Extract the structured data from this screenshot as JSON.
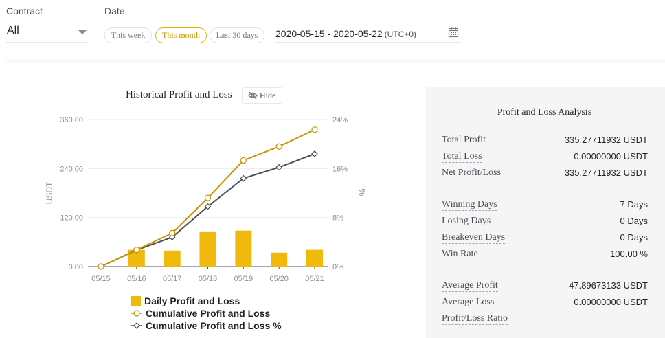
{
  "filters": {
    "contract_label": "Contract",
    "contract_value": "All",
    "date_label": "Date",
    "presets": [
      "This week",
      "This month",
      "Last 30 days"
    ],
    "active_preset": "This month",
    "date_range": "2020-05-15 - 2020-05-22",
    "timezone": "(UTC+0)",
    "icons": {
      "dropdown": "chevron-down-icon",
      "calendar": "calendar-icon"
    }
  },
  "chart_header": {
    "title": "Historical Profit and Loss",
    "hide_label": "Hide",
    "hide_icon": "eye-slash-icon"
  },
  "chart_data": {
    "type": "bar",
    "categories": [
      "05/15",
      "05/16",
      "05/17",
      "05/18",
      "05/19",
      "05/20",
      "05/21"
    ],
    "ylabel": "USDT",
    "y2label": "%",
    "ylim": [
      0,
      360
    ],
    "y2lim": [
      0,
      24
    ],
    "yticks": [
      "0.00",
      "120.00",
      "240.00",
      "360.00"
    ],
    "y2ticks": [
      "0%",
      "8%",
      "16%",
      "24%"
    ],
    "series": [
      {
        "name": "Daily Profit and Loss",
        "type": "bar",
        "axis": "left",
        "values": [
          0,
          41,
          39,
          86,
          88,
          34,
          41
        ],
        "color": "#f0b90b"
      },
      {
        "name": "Cumulative Profit and Loss",
        "type": "line",
        "axis": "left",
        "marker": "circle",
        "values": [
          0,
          41,
          82,
          168,
          260,
          294,
          335.28
        ],
        "color": "#c99400"
      },
      {
        "name": "Cumulative Profit and Loss %",
        "type": "line",
        "axis": "right",
        "marker": "diamond",
        "values": [
          0,
          2.7,
          4.8,
          9.8,
          14.4,
          16.2,
          18.4
        ],
        "color": "#474d57"
      }
    ],
    "grid": true,
    "legend_position": "bottom"
  },
  "analysis": {
    "title": "Profit and Loss Analysis",
    "rows": [
      {
        "label": "Total Profit",
        "value": "335.27711932 USDT"
      },
      {
        "label": "Total Loss",
        "value": "0.00000000 USDT"
      },
      {
        "label": "Net Profit/Loss",
        "value": "335.27711932 USDT"
      },
      {
        "label": "Winning Days",
        "value": "7 Days"
      },
      {
        "label": "Losing Days",
        "value": "0 Days"
      },
      {
        "label": "Breakeven Days",
        "value": "0 Days"
      },
      {
        "label": "Win Rate",
        "value": "100.00 %"
      },
      {
        "label": "Average Profit",
        "value": "47.89673133 USDT"
      },
      {
        "label": "Average Loss",
        "value": "0.00000000 USDT"
      },
      {
        "label": "Profit/Loss Ratio",
        "value": "-"
      }
    ]
  },
  "colors": {
    "accent": "#f0b90b",
    "accent_dark": "#c99400",
    "line_dark": "#474d57"
  }
}
